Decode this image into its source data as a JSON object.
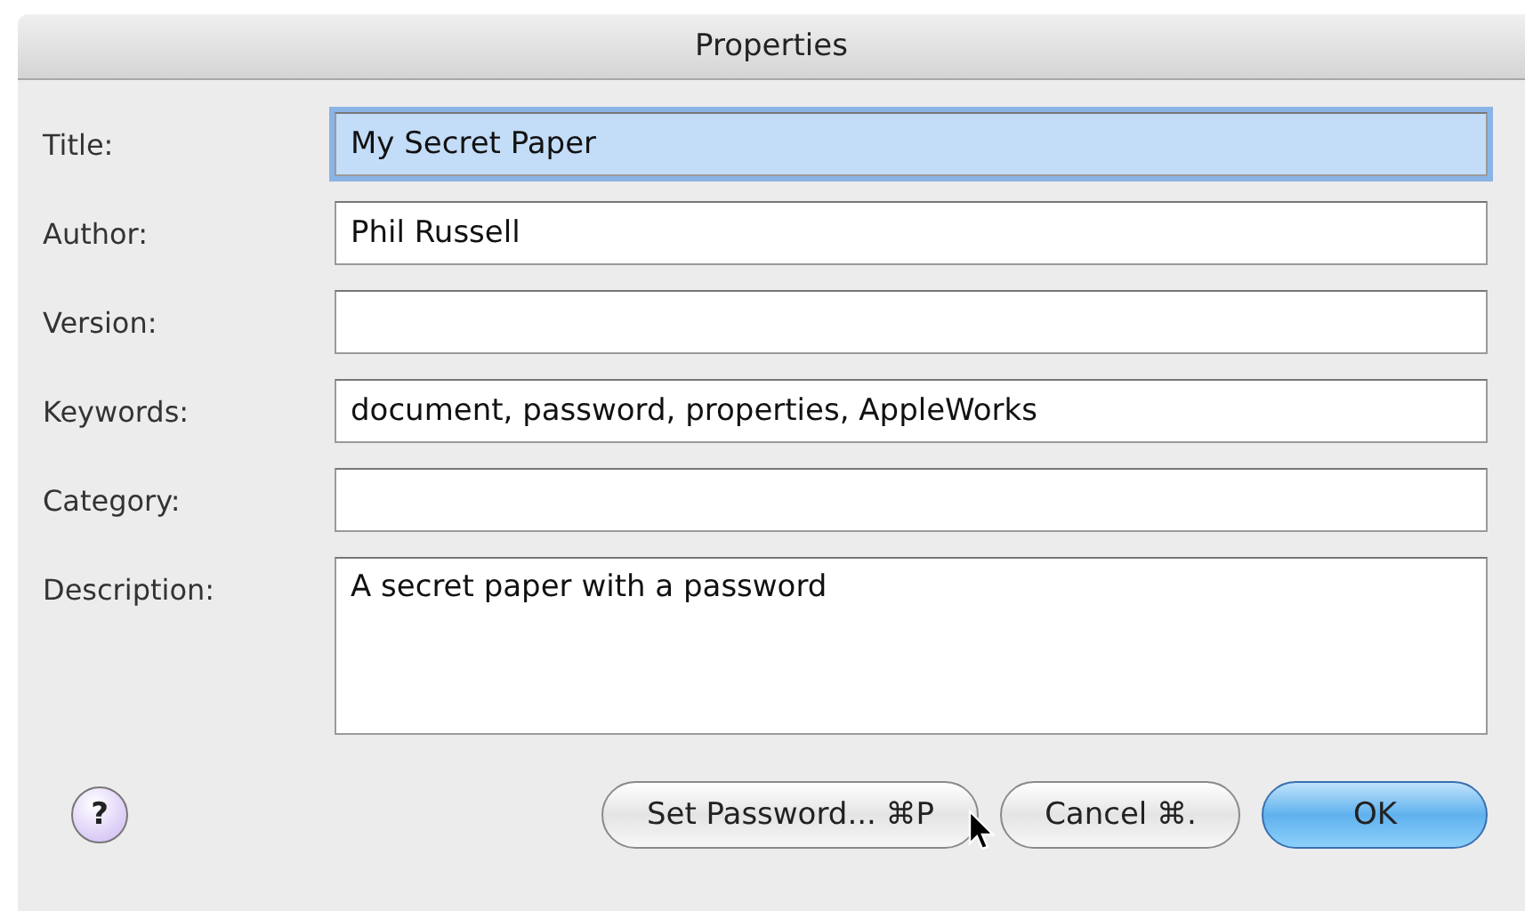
{
  "window": {
    "title": "Properties"
  },
  "fields": [
    {
      "label": "Title:",
      "value": "My Secret Paper",
      "kind": "line",
      "focused": true
    },
    {
      "label": "Author:",
      "value": "Phil Russell",
      "kind": "line",
      "focused": false
    },
    {
      "label": "Version:",
      "kind": "line",
      "focused": false
    },
    {
      "label": "Keywords:",
      "value": "document, password, properties, AppleWorks",
      "kind": "line",
      "focused": false
    },
    {
      "label": "Category:",
      "kind": "line",
      "focused": false
    },
    {
      "label": "Description:",
      "value": "A secret paper with a password",
      "kind": "area",
      "focused": false
    }
  ],
  "help": {
    "label": "?"
  },
  "buttons": [
    {
      "label": "Set Password... ⌘P",
      "default": false
    },
    {
      "label": "Cancel ⌘.",
      "default": false
    },
    {
      "label": "OK",
      "default": true
    }
  ]
}
